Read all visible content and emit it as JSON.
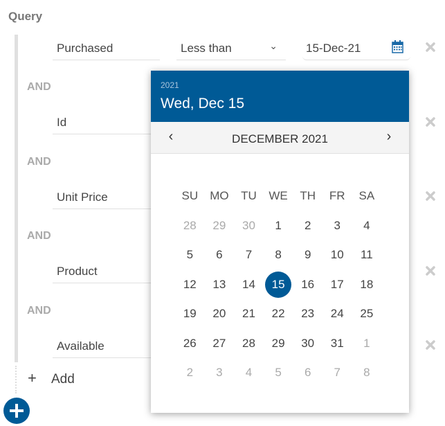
{
  "query": {
    "title": "Query",
    "conjunction": "AND",
    "conditions": [
      {
        "field": "Purchased",
        "operator": "Less than",
        "value": "15-Dec-21"
      },
      {
        "field": "Id"
      },
      {
        "field": "Unit Price"
      },
      {
        "field": "Product"
      },
      {
        "field": "Available"
      }
    ],
    "add_label": "Add"
  },
  "icons": {
    "operator_dropdown": "chevron-down-icon",
    "date": "calendar-icon",
    "remove": "close-icon",
    "add": "plus-icon",
    "fab": "plus-circle-icon"
  },
  "colors": {
    "accent": "#005a96",
    "muted": "#aaaaaa"
  },
  "datepicker": {
    "year": "2021",
    "selected_label": "Wed, Dec 15",
    "month_label": "DECEMBER 2021",
    "prev": "‹",
    "next": "›",
    "weekdays": [
      "SU",
      "MO",
      "TU",
      "WE",
      "TH",
      "FR",
      "SA"
    ],
    "weeks": [
      [
        {
          "d": "28",
          "o": true
        },
        {
          "d": "29",
          "o": true
        },
        {
          "d": "30",
          "o": true
        },
        {
          "d": "1"
        },
        {
          "d": "2"
        },
        {
          "d": "3"
        },
        {
          "d": "4"
        }
      ],
      [
        {
          "d": "5"
        },
        {
          "d": "6"
        },
        {
          "d": "7"
        },
        {
          "d": "8"
        },
        {
          "d": "9"
        },
        {
          "d": "10"
        },
        {
          "d": "11"
        }
      ],
      [
        {
          "d": "12"
        },
        {
          "d": "13"
        },
        {
          "d": "14"
        },
        {
          "d": "15",
          "s": true
        },
        {
          "d": "16"
        },
        {
          "d": "17"
        },
        {
          "d": "18"
        }
      ],
      [
        {
          "d": "19"
        },
        {
          "d": "20"
        },
        {
          "d": "21"
        },
        {
          "d": "22"
        },
        {
          "d": "23"
        },
        {
          "d": "24"
        },
        {
          "d": "25"
        }
      ],
      [
        {
          "d": "26"
        },
        {
          "d": "27"
        },
        {
          "d": "28"
        },
        {
          "d": "29"
        },
        {
          "d": "30"
        },
        {
          "d": "31"
        },
        {
          "d": "1",
          "o": true
        }
      ],
      [
        {
          "d": "2",
          "o": true
        },
        {
          "d": "3",
          "o": true
        },
        {
          "d": "4",
          "o": true
        },
        {
          "d": "5",
          "o": true
        },
        {
          "d": "6",
          "o": true
        },
        {
          "d": "7",
          "o": true
        },
        {
          "d": "8",
          "o": true
        }
      ]
    ]
  }
}
